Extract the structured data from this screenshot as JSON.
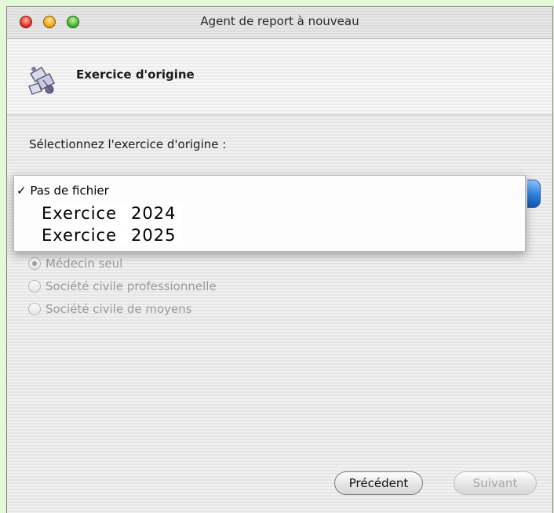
{
  "window": {
    "title": "Agent de report à nouveau"
  },
  "header": {
    "step_title": "Exercice d'origine",
    "icon": "assistant-sheets-icon"
  },
  "prompt": {
    "label": "Sélectionnez l'exercice d'origine :"
  },
  "popup_menu": {
    "checkmark": "✓",
    "items": [
      {
        "label": "Pas de fichier",
        "checked": true
      },
      {
        "word": "Exercice",
        "year": "2024"
      },
      {
        "word": "Exercice",
        "year": "2025"
      }
    ]
  },
  "structure_options": {
    "items": [
      {
        "label": "Médecin seul",
        "selected": true
      },
      {
        "label": "Société civile professionnelle",
        "selected": false
      },
      {
        "label": "Société civile de moyens",
        "selected": false
      }
    ]
  },
  "footer": {
    "previous_label": "Précédent",
    "next_label": "Suivant"
  },
  "colors": {
    "page_background": "#e2f8d6",
    "popup_accent": "#2b7fe0",
    "disabled_text": "#9a9a9a"
  }
}
